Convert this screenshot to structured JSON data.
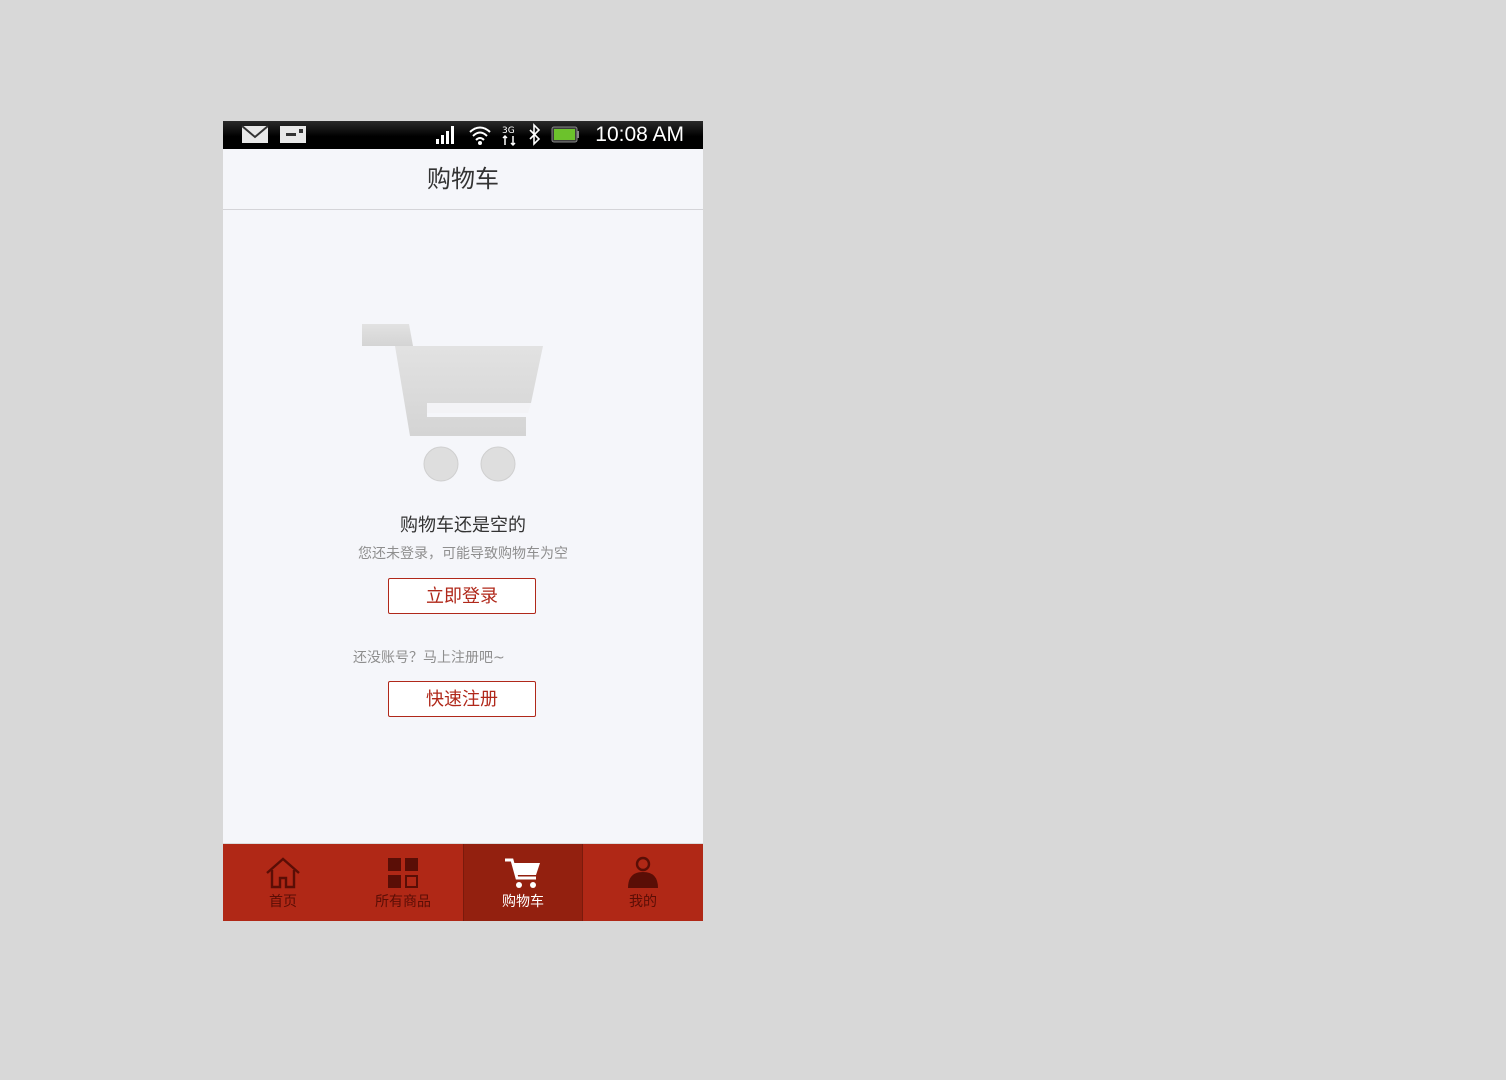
{
  "status_bar": {
    "time": "10:08 AM",
    "icons": [
      "mail-icon",
      "sim-card-icon",
      "signal-icon",
      "wifi-icon",
      "3g-icon",
      "bluetooth-icon",
      "battery-icon"
    ]
  },
  "header": {
    "title": "购物车"
  },
  "empty_state": {
    "icon": "cart-illustration-icon",
    "title": "购物车还是空的",
    "subtitle": "您还未登录，可能导致购物车为空",
    "login_label": "立即登录",
    "register_hint": "还没账号？马上注册吧~",
    "register_label": "快速注册"
  },
  "tabbar": {
    "active_index": 2,
    "items": [
      {
        "label": "首页",
        "icon": "home-icon"
      },
      {
        "label": "所有商品",
        "icon": "grid-icon"
      },
      {
        "label": "购物车",
        "icon": "cart-icon"
      },
      {
        "label": "我的",
        "icon": "user-icon"
      }
    ]
  },
  "colors": {
    "brand_red": "#b02816",
    "active_tab": "#93200f",
    "button_text": "#b0281a",
    "background": "#f5f6fa"
  }
}
